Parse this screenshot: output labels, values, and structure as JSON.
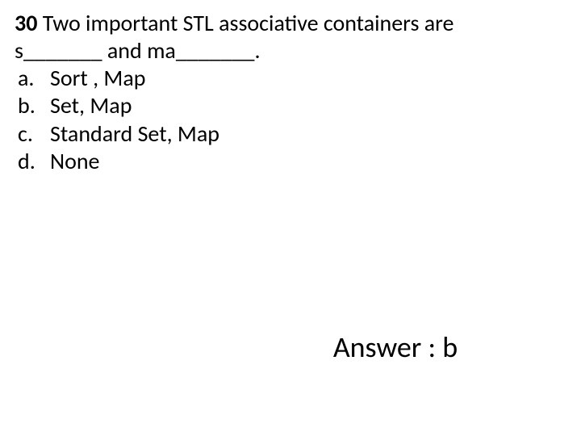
{
  "question": {
    "number": "30",
    "line1_after_number": " Two important STL associative containers are",
    "line2": "s_______ and ma_______.",
    "options": [
      {
        "label": "a.",
        "text": "Sort , Map"
      },
      {
        "label": "b.",
        "text": "Set, Map"
      },
      {
        "label": "c.",
        "text": "Standard Set, Map"
      },
      {
        "label": "d.",
        "text": "None"
      }
    ]
  },
  "answer": {
    "text": "Answer : b"
  }
}
